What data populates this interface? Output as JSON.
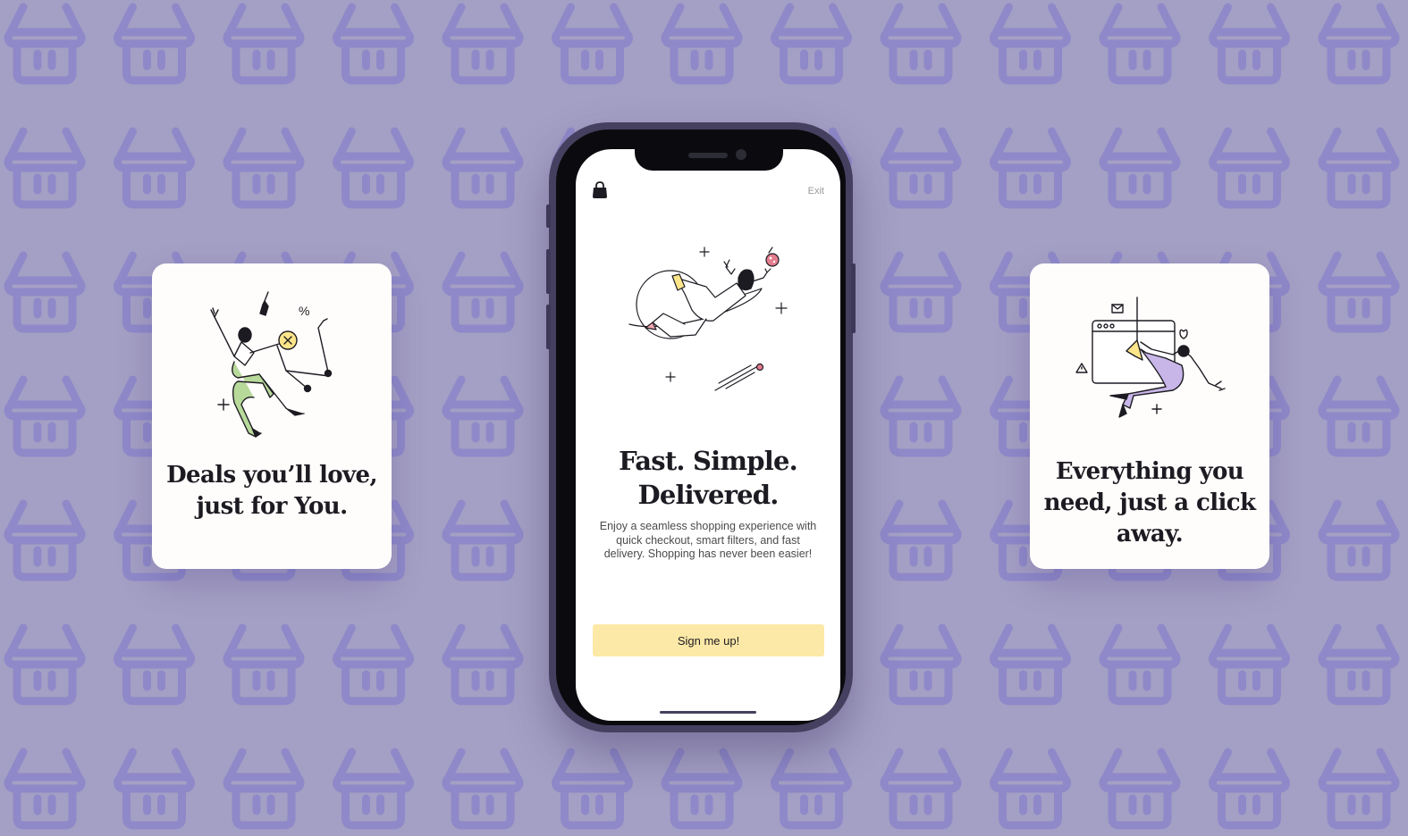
{
  "background": {
    "color": "#a49fc4",
    "pattern_icon": "shopping-basket-icon",
    "pattern_color": "#8f89c9"
  },
  "left_card": {
    "title_line1": "Deals you’ll love,",
    "title_line2": "just for You.",
    "illustration": "woman-with-shopping-cart-icon"
  },
  "phone": {
    "top_bar": {
      "logo_icon": "shopping-bag-icon",
      "exit_label": "Exit"
    },
    "hero": {
      "illustration": "astronaut-floating-with-planet-icon",
      "title_line1": "Fast. Simple.",
      "title_line2": "Delivered.",
      "description_line1": "Enjoy a seamless shopping experience with",
      "description_line2": "quick checkout, smart filters, and fast",
      "description_line3": "delivery. Shopping has never been easier!"
    },
    "cta_label": "Sign me up!",
    "cta_color": "#fde9a7"
  },
  "right_card": {
    "title_line1": "Everything you",
    "title_line2": "need, just a click",
    "title_line3": "away.",
    "illustration": "person-with-browser-cursor-icon"
  }
}
